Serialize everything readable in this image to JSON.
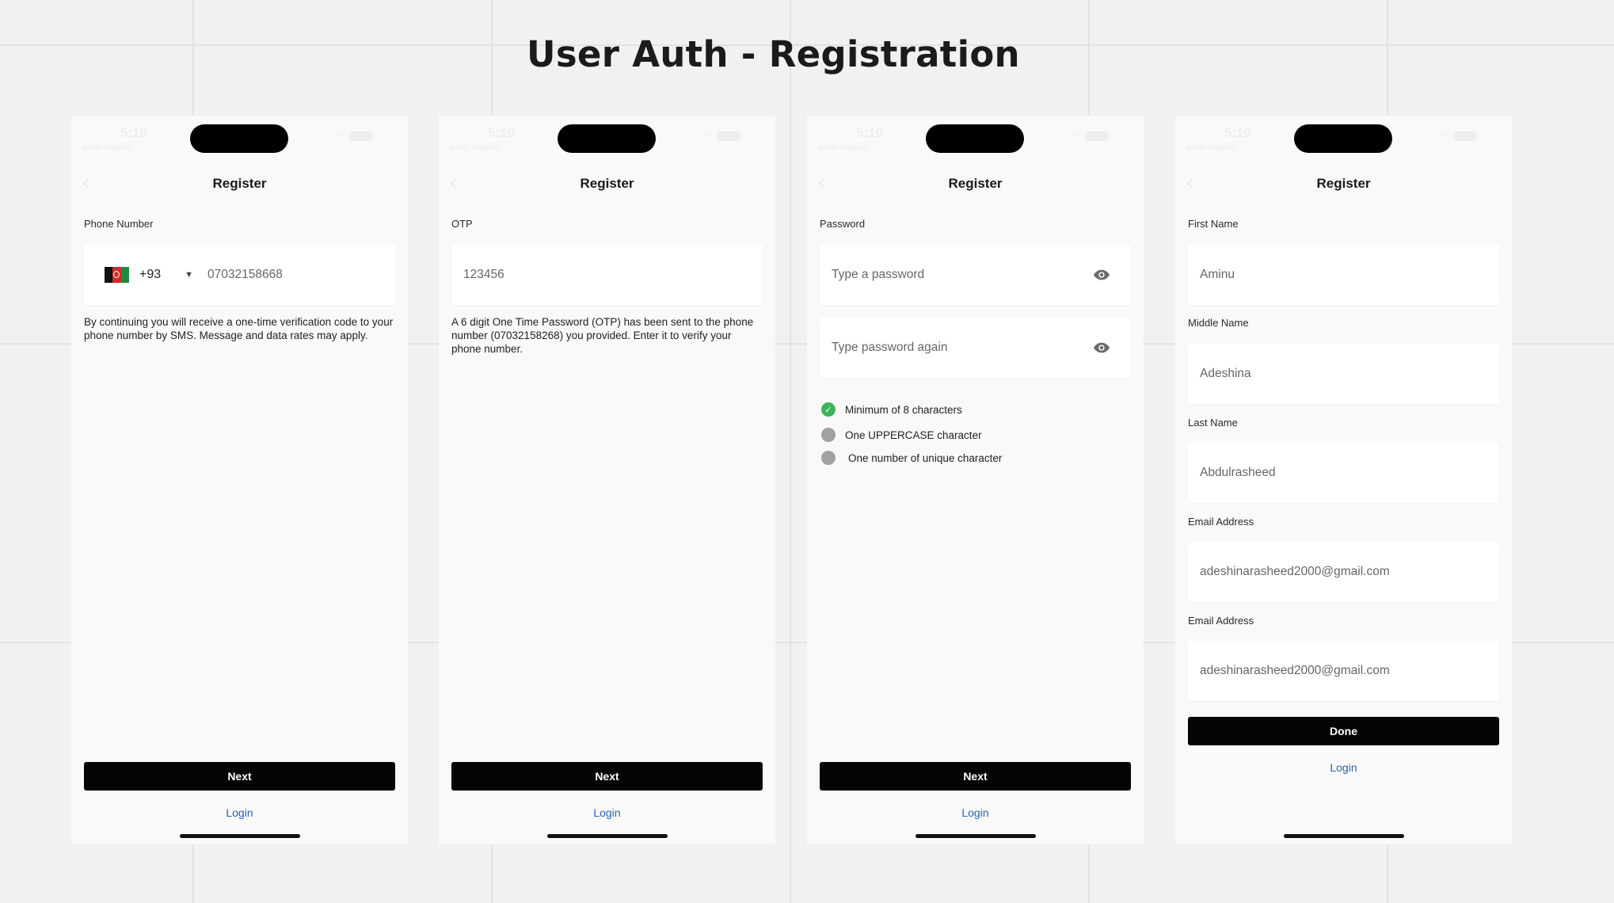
{
  "page": {
    "title": "User Auth - Registration"
  },
  "status_bar": {
    "time": "5:10",
    "carrier": "Airtel Nigeria"
  },
  "screens": [
    {
      "nav_title": "Register",
      "phone_label": "Phone Number",
      "country_code": "+93",
      "phone_value": "07032158668",
      "disclaimer": "By continuing you will receive a one-time verification code to your phone number by SMS. Message and data rates may apply.",
      "next_label": "Next",
      "login_label": "Login"
    },
    {
      "nav_title": "Register",
      "otp_label": "OTP",
      "otp_value": "123456",
      "otp_info": "A 6 digit One Time Password (OTP) has been sent to the phone number (07032158268) you provided. Enter it to verify your phone number.",
      "next_label": "Next",
      "login_label": "Login"
    },
    {
      "nav_title": "Register",
      "password_label": "Password",
      "password_placeholder": "Type a password",
      "confirm_placeholder": "Type password again",
      "rules": [
        {
          "text": "Minimum of 8 characters",
          "met": true
        },
        {
          "text": "One UPPERCASE character",
          "met": false
        },
        {
          "text": "One number of unique character",
          "met": false
        }
      ],
      "next_label": "Next",
      "login_label": "Login"
    },
    {
      "nav_title": "Register",
      "first_name_label": "First Name",
      "first_name_value": "Aminu",
      "middle_name_label": "Middle Name",
      "middle_name_value": "Adeshina",
      "last_name_label": "Last Name",
      "last_name_value": "Abdulrasheed",
      "email_label": "Email Address",
      "email_value": "adeshinarasheed2000@gmail.com",
      "email2_label": "Email Address",
      "email2_value": "adeshinarasheed2000@gmail.com",
      "done_label": "Done",
      "login_label": "Login"
    }
  ],
  "colors": {
    "primary": "#050505",
    "link": "#2a62b8",
    "success": "#3eb357",
    "inactive": "#a1a1a1"
  }
}
